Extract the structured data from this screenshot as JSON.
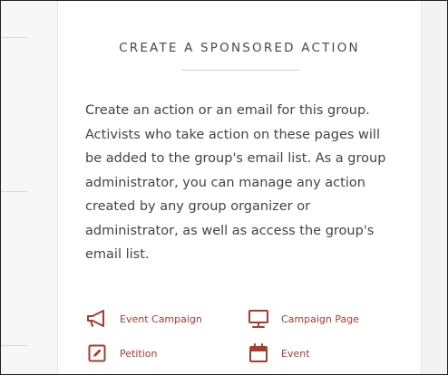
{
  "card": {
    "title": "CREATE A SPONSORED ACTION",
    "description": "Create an action or an email for this group. Activists who take action on these pages will be added to the group's email list. As a group administrator, you can manage any action created by any group organizer or administrator, as well as access the group's email list."
  },
  "actions": [
    {
      "label": "Event Campaign",
      "icon": "megaphone-icon"
    },
    {
      "label": "Campaign Page",
      "icon": "monitor-icon"
    },
    {
      "label": "Petition",
      "icon": "pencil-icon"
    },
    {
      "label": "Event",
      "icon": "calendar-icon"
    }
  ],
  "colors": {
    "accent": "#a93a2c",
    "text": "#444444",
    "card_bg": "#ffffff",
    "page_bg": "#f4f4f4"
  }
}
